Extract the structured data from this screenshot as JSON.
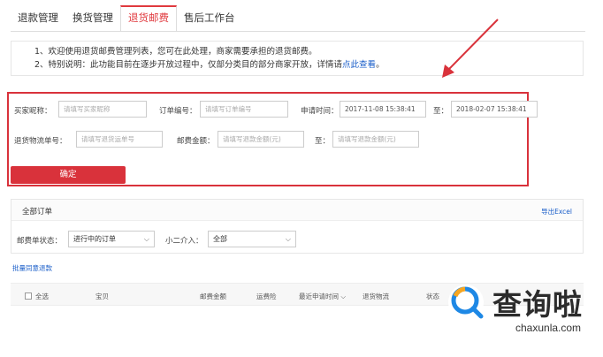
{
  "tabs": [
    {
      "label": "退款管理",
      "active": false
    },
    {
      "label": "换货管理",
      "active": false
    },
    {
      "label": "退货邮费",
      "active": true
    },
    {
      "label": "售后工作台",
      "active": false
    }
  ],
  "notice": {
    "line1": "1、欢迎使用退货邮费管理列表，您可在此处理，商家需要承担的退货邮费。",
    "line2_prefix": "2、特别说明：此功能目前在逐步开放过程中，仅部分类目的部分商家开放，详情请",
    "line2_link": "点此查看",
    "line2_suffix": "。"
  },
  "filter": {
    "buyer_label": "买家昵称：",
    "buyer_placeholder": "请填写买家昵称",
    "order_label": "订单编号：",
    "order_placeholder": "请填写订单编号",
    "time_label": "申请时间：",
    "time_start": "2017-11-08 15:38:41",
    "time_to": "至：",
    "time_end": "2018-02-07 15:38:41",
    "logistics_label": "退货物流单号：",
    "logistics_placeholder": "请填写退货运单号",
    "amount_label": "邮费金额：",
    "amount_min_placeholder": "请填写退款金额(元)",
    "amount_to": "至：",
    "amount_max_placeholder": "请填写退款金额(元)",
    "confirm_label": "确定"
  },
  "orders": {
    "title": "全部订单",
    "export_label": "导出Excel",
    "status_label": "邮费单状态：",
    "status_value": "进行中的订单",
    "xiaoer_label": "小二介入：",
    "xiaoer_value": "全部"
  },
  "batch_label": "批量同意退款",
  "table_headers": {
    "select_all": "全选",
    "item": "宝贝",
    "postage": "邮费金额",
    "shipping_insurance": "运费险",
    "latest_time": "最近申请时间",
    "logistics": "退货物流",
    "status": "状态"
  },
  "watermark": {
    "text": "查询啦",
    "domain": "chaxunla.com"
  },
  "colors": {
    "accent_red": "#d9323b",
    "link_blue": "#1a5ec9"
  }
}
